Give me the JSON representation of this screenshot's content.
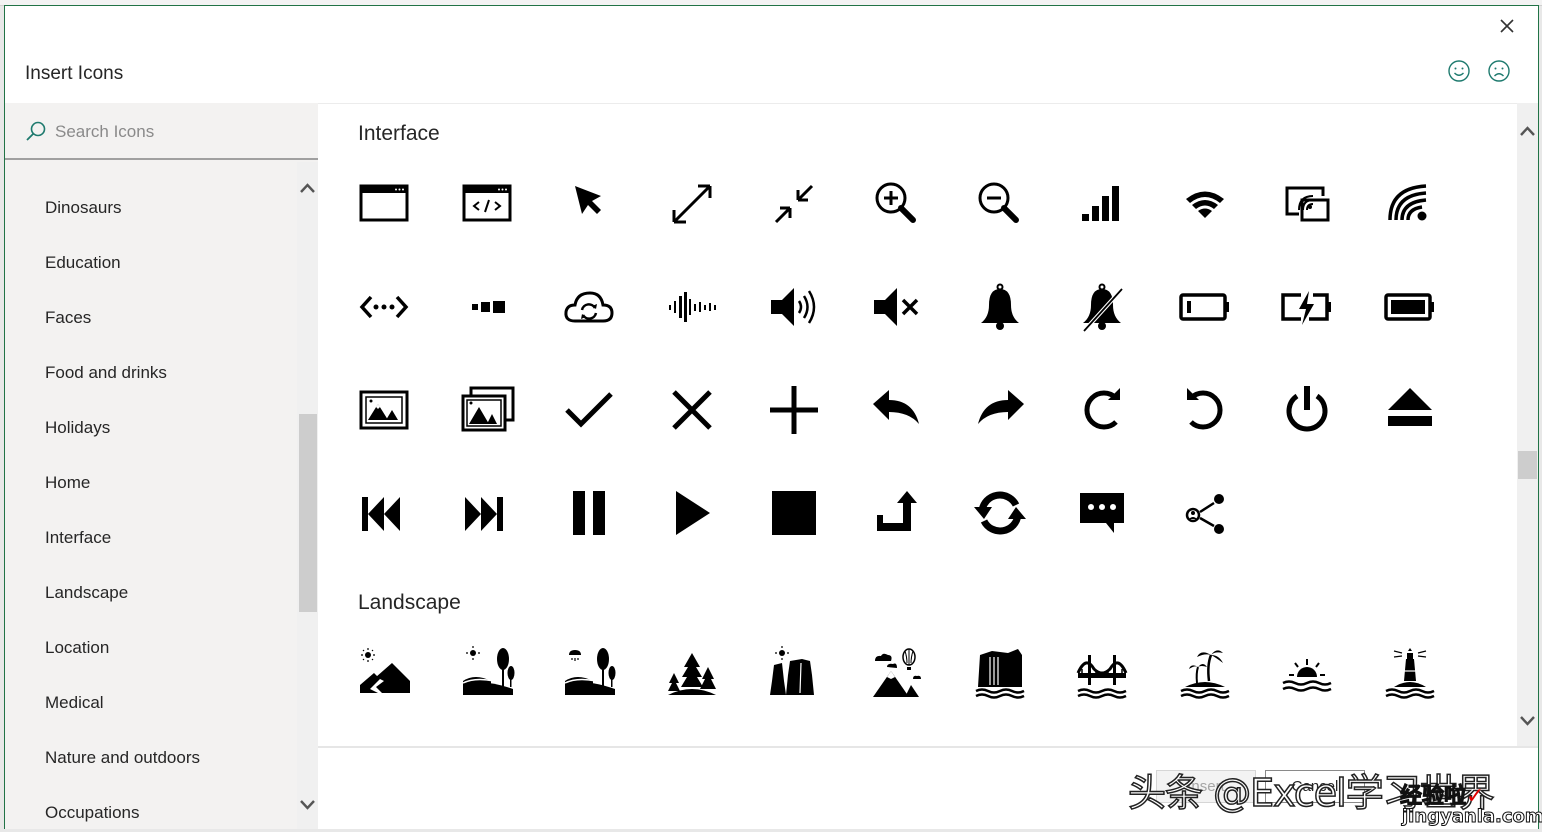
{
  "dialog": {
    "title": "Insert Icons",
    "close_icon": "close-icon",
    "feedback": [
      {
        "name": "smile-feedback-icon",
        "label": "Send a smile"
      },
      {
        "name": "frown-feedback-icon",
        "label": "Send a frown"
      }
    ]
  },
  "search": {
    "placeholder": "Search Icons",
    "value": "",
    "icon": "search-icon"
  },
  "categories": [
    "Dinosaurs",
    "Education",
    "Faces",
    "Food and drinks",
    "Holidays",
    "Home",
    "Interface",
    "Landscape",
    "Location",
    "Medical",
    "Nature and outdoors",
    "Occupations"
  ],
  "sections": [
    {
      "title": "Interface",
      "icons": [
        "window",
        "code-window",
        "cursor-arrow",
        "expand-arrows",
        "collapse-arrows",
        "zoom-in",
        "zoom-out",
        "signal-bars",
        "wifi",
        "cast-screen",
        "wireless-signal",
        "network-connection",
        "progress-dots",
        "cloud-sync",
        "audio-waveform",
        "speaker-volume",
        "speaker-mute",
        "bell",
        "bell-off",
        "battery-low",
        "battery-charging",
        "battery-full",
        "picture",
        "pictures",
        "checkmark",
        "close-x",
        "plus",
        "reply-arrow",
        "forward-arrow",
        "refresh-clockwise",
        "refresh-counterclockwise",
        "power",
        "eject",
        "skip-back",
        "skip-forward",
        "pause",
        "play",
        "stop",
        "turn-up-arrow",
        "sync",
        "chat-bubble",
        "share-contact"
      ]
    },
    {
      "title": "Landscape",
      "icons": [
        "mountain-sun",
        "hills-trees-sun",
        "hills-trees-rain",
        "forest",
        "canyon-sun",
        "mountain-balloon",
        "waterfall",
        "bridge-water",
        "island-palm",
        "sunset-water",
        "lighthouse"
      ]
    }
  ],
  "footer": {
    "insert_label": "Insert",
    "cancel_label": "Cancel"
  },
  "watermark": {
    "text": "头条 @Excel学习世界",
    "badge": "经验啦",
    "badge_mark": "✓",
    "site": "jingyanla.com"
  }
}
